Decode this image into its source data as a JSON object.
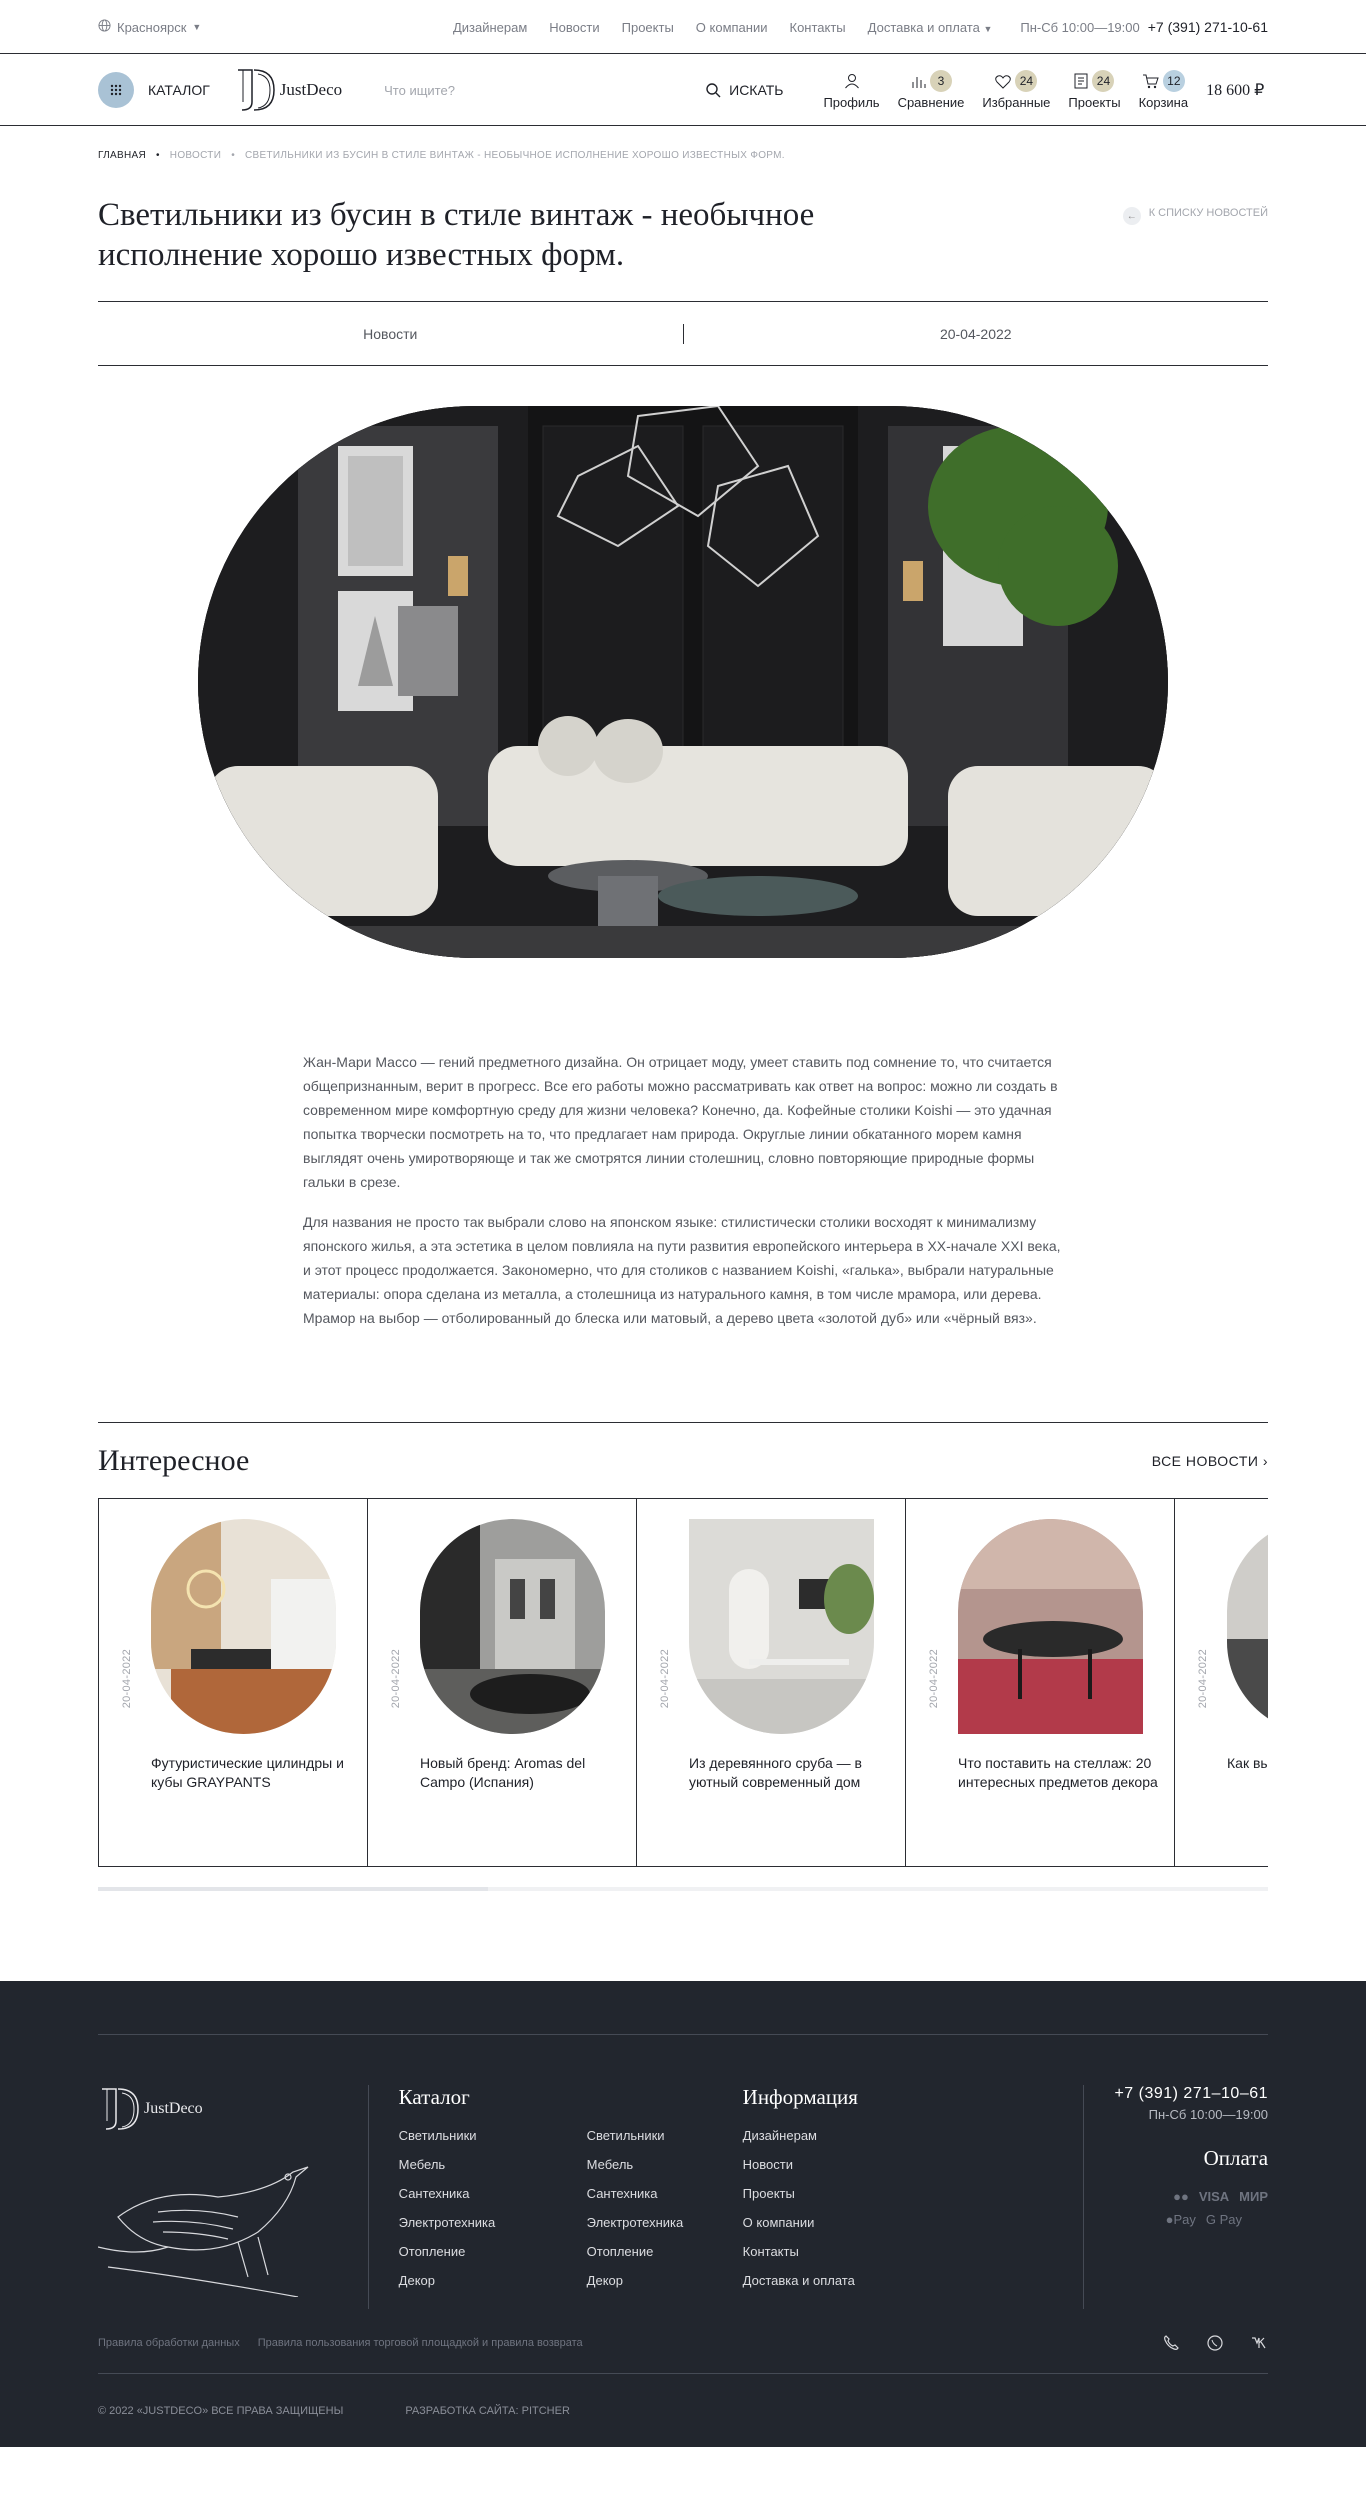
{
  "topbar": {
    "city": "Красноярск",
    "nav": [
      "Дизайнерам",
      "Новости",
      "Проекты",
      "О компании",
      "Контакты",
      "Доставка и оплата"
    ],
    "worktime": "Пн-Сб 10:00—19:00",
    "phone": "+7 (391) 271-10-61"
  },
  "header": {
    "catalog_label": "КАТАЛОГ",
    "logo_text": "JustDeco",
    "search_placeholder": "Что ищите?",
    "search_button": "ИСКАТЬ",
    "icons": [
      {
        "label": "Профиль",
        "badge": ""
      },
      {
        "label": "Сравнение",
        "badge": "3"
      },
      {
        "label": "Избранные",
        "badge": "24"
      },
      {
        "label": "Проекты",
        "badge": "24"
      },
      {
        "label": "Корзина",
        "badge": "12"
      }
    ],
    "cart_sum": "18 600 ₽"
  },
  "breadcrumbs": [
    "ГЛАВНАЯ",
    "НОВОСТИ",
    "СВЕТИЛЬНИКИ ИЗ БУСИН В СТИЛЕ ВИНТАЖ - НЕОБЫЧНОЕ ИСПОЛНЕНИЕ ХОРОШО ИЗВЕСТНЫХ ФОРМ."
  ],
  "article": {
    "title": "Светильники из бусин в стиле винтаж - необычное исполнение хорошо известных форм.",
    "back_label": "К СПИСКУ НОВОСТЕЙ",
    "category": "Новости",
    "date": "20-04-2022",
    "paragraphs": [
      "Жан-Мари Массо — гений предметного дизайна. Он отрицает моду, умеет ставить под сомнение то, что считается общепризнанным, верит в прогресс. Все его работы можно рассматривать как ответ на вопрос: можно ли создать в современном мире комфортную среду для жизни человека? Конечно, да. Кофейные столики Koishi — это удачная попытка творчески посмотреть на то, что предлагает нам природа. Округлые линии обкатанного морем камня выглядят очень умиротворяюще и так же смотрятся линии столешниц, словно повторяющие природные формы гальки в срезе.",
      "Для названия не просто так выбрали слово на японском языке: стилистически столики восходят к минимализму японского жилья, а эта эстетика в целом повлияла на пути развития европейского интерьера в XX-начале XXI века, и этот процесс продолжается. Закономерно, что для столиков с названием Koishi, «галька», выбрали натуральные материалы: опора сделана из металла, а столешница из натурального камня, в том числе мрамора, или дерева. Мрамор на выбор — отболированный до блеска или матовый, а дерево цвета «золотой дуб» или «чёрный вяз»."
    ]
  },
  "interesting": {
    "title": "Интересное",
    "all_news": "ВСЕ НОВОСТИ",
    "cards": [
      {
        "date": "20-04-2022",
        "title": "Футуристические цилиндры и кубы GRAYPANTS"
      },
      {
        "date": "20-04-2022",
        "title": "Новый бренд: Aromas del Campo (Испания)"
      },
      {
        "date": "20-04-2022",
        "title": "Из деревянного сруба — в уютный современный дом"
      },
      {
        "date": "20-04-2022",
        "title": "Что поставить на стеллаж: 20 интересных предметов декора"
      },
      {
        "date": "20-04-2022",
        "title": "Как вы… дизай… Катан…"
      }
    ]
  },
  "footer": {
    "logo_text": "JustDeco",
    "catalog_title": "Каталог",
    "catalog_links": [
      "Светильники",
      "Светильники",
      "Мебель",
      "Мебель",
      "Сантехника",
      "Сантехника",
      "Электротехника",
      "Электротехника",
      "Отопление",
      "Отопление",
      "Декор",
      "Декор"
    ],
    "info_title": "Информация",
    "info_links": [
      "Дизайнерам",
      "Новости",
      "Проекты",
      "О компании",
      "Контакты",
      "Доставка и оплата"
    ],
    "phone": "+7 (391) 271–10–61",
    "worktime": "Пн-Сб 10:00—19:00",
    "payment_title": "Оплата",
    "payments_row1": [
      "●●",
      "VISA",
      "МИР"
    ],
    "payments_row2": [
      "Pay",
      "G Pay"
    ],
    "legal": [
      "Правила обработки данных",
      "Правила пользования торговой площадкой и правила возврата"
    ],
    "copyright": "© 2022 «JUSTDECO» ВСЕ ПРАВА ЗАЩИЩЕНЫ",
    "developer": "РАЗРАБОТКА САЙТА: PITCHER"
  },
  "colors": {
    "accent_blue": "#a9c2d5",
    "badge_beige": "#d8d2b8",
    "footer_bg": "#22262e"
  }
}
